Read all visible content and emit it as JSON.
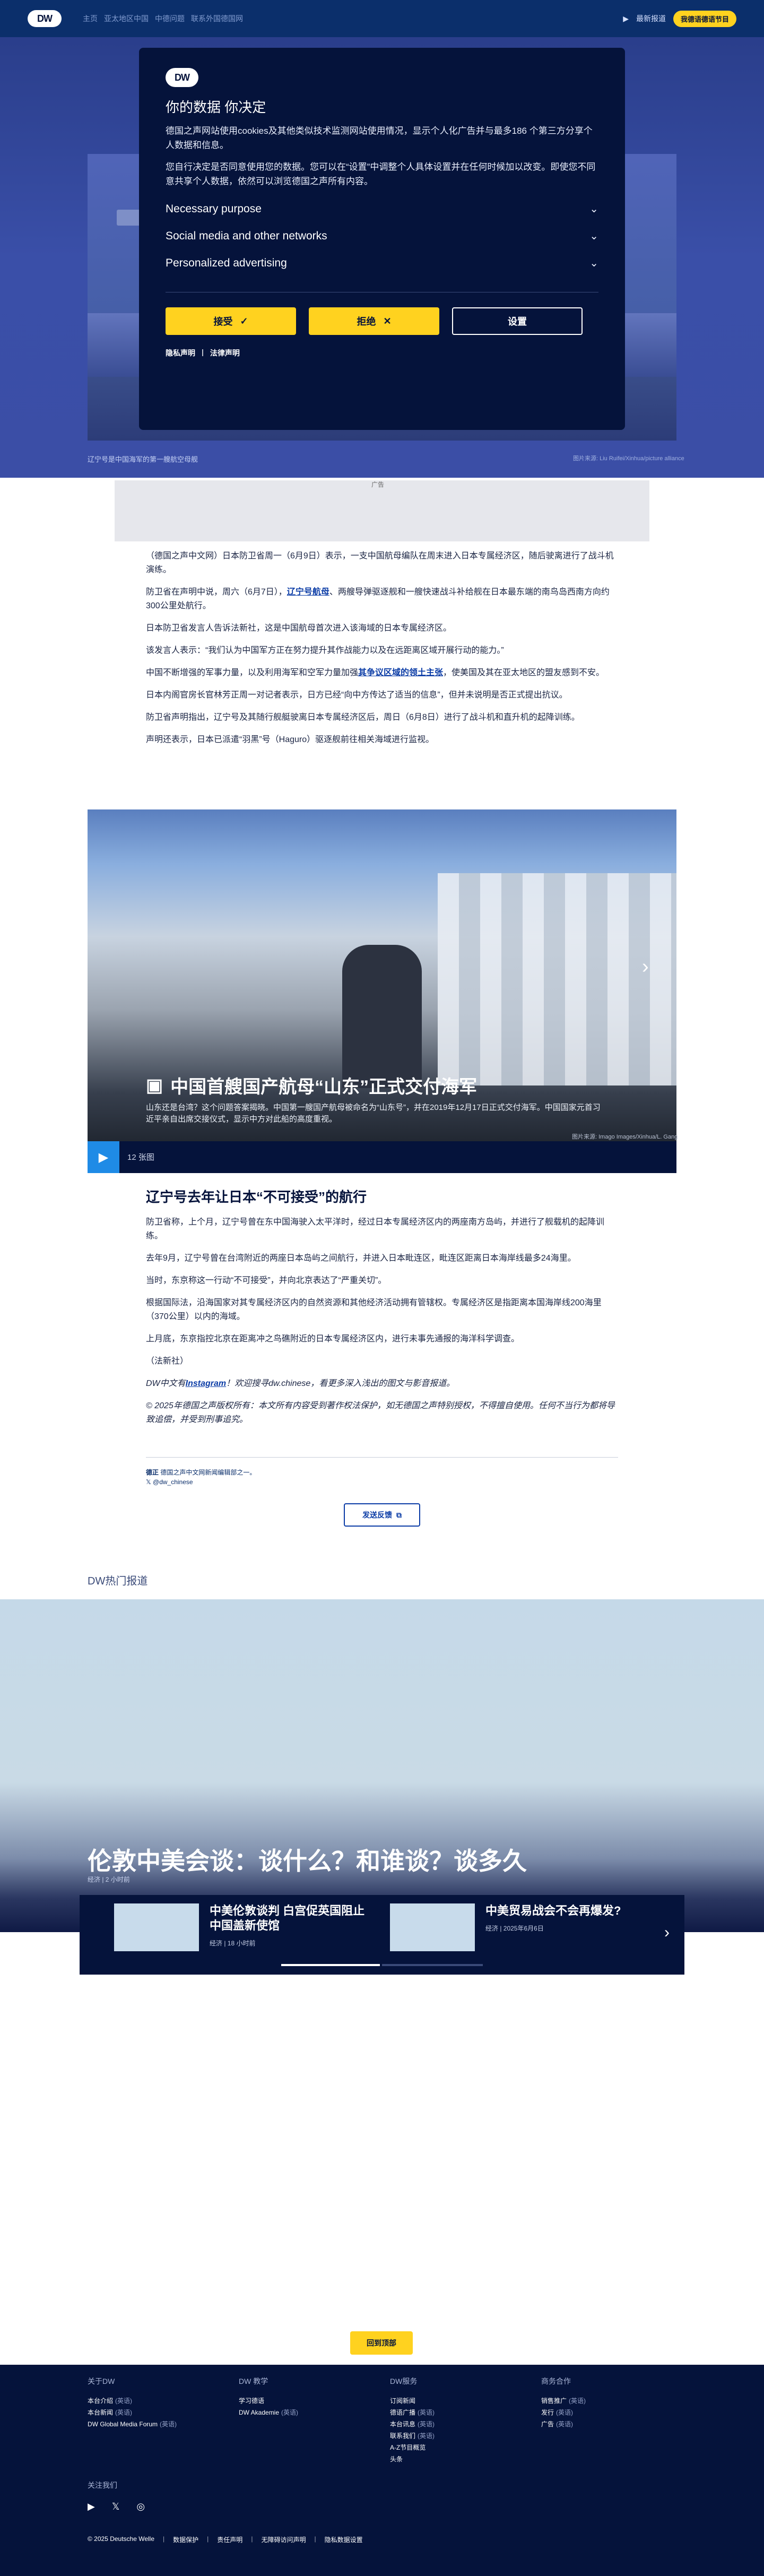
{
  "header": {
    "logo": "DW",
    "breadcrumbs": [
      "主页",
      "亚太地区中国",
      "中德问题",
      "联系外国德国网"
    ],
    "right_link_1": "最新报道",
    "lang_pill": "我德语德语节目"
  },
  "hero": {
    "caption": "辽宁号是中国海军的第一艘航空母舰",
    "credit": "图片来源: Liu Ruifei/Xinhua/picture alliance"
  },
  "consent": {
    "logo": "DW",
    "title": "你的数据 你决定",
    "p1": "德国之声网站使用cookies及其他类似技术监测网站使用情况，显示个人化广告并与最多186 个第三方分享个人数据和信息。",
    "p2": "您自行决定是否同意使用您的数据。您可以在“设置”中调整个人具体设置并在任何时候加以改变。即使您不同意共享个人数据，依然可以浏览德国之声所有内容。",
    "purposes": [
      "Necessary purpose",
      "Social media and other networks",
      "Personalized advertising"
    ],
    "accept": "接受",
    "reject": "拒绝",
    "settings": "设置",
    "privacy": "隐私声明",
    "legal": "法律声明"
  },
  "ad": {
    "label": "广告"
  },
  "article": {
    "p1": "（德国之声中文网）日本防卫省周一（6月9日）表示，一支中国航母编队在周末进入日本专属经济区，随后驶离进行了战斗机演练。",
    "p2a": "防卫省在声明中说，周六（6月7日），",
    "p2link": "辽宁号航母",
    "p2b": "、两艘导弹驱逐舰和一艘快速战斗补给舰在日本最东端的南鸟岛西南方向约300公里处航行。",
    "p3": "日本防卫省发言人告诉法新社，这是中国航母首次进入该海域的日本专属经济区。",
    "p4": "该发言人表示：“我们认为中国军方正在努力提升其作战能力以及在远距离区域开展行动的能力。”",
    "p5a": "中国不断增强的军事力量，以及利用海军和空军力量加强",
    "p5link": "其争议区域的领土主张",
    "p5b": "，使美国及其在亚太地区的盟友感到不安。",
    "p6": "日本内阁官房长官林芳正周一对记者表示，日方已经“向中方传达了适当的信息”，但并未说明是否正式提出抗议。",
    "p7": "防卫省声明指出，辽宁号及其随行舰艇驶离日本专属经济区后，周日（6月8日）进行了战斗机和直升机的起降训练。",
    "p8": "声明还表示，日本已派遣“羽黑”号（Haguro）驱逐舰前往相关海域进行监视。",
    "h3": "辽宁号去年让日本“不可接受”的航行",
    "p9": "防卫省称，上个月，辽宁号曾在东中国海驶入太平洋时，经过日本专属经济区内的两座南方岛屿，并进行了舰载机的起降训练。",
    "p10": "去年9月，辽宁号曾在台湾附近的两座日本岛屿之间航行，并进入日本毗连区，毗连区距离日本海岸线最多24海里。",
    "p11": "当时，东京称这一行动“不可接受”，并向北京表达了“严重关切”。",
    "p12": "根据国际法，沿海国家对其专属经济区内的自然资源和其他经济活动拥有管辖权。专属经济区是指距离本国海岸线200海里（370公里）以内的海域。",
    "p13": "上月底，东京指控北京在距离冲之鸟礁附近的日本专属经济区内，进行未事先通报的海洋科学调查。",
    "p14": "（法新社）",
    "p15a": "DW中文有",
    "p15link": "Instagram",
    "p15b": "！欢迎搜寻dw.chinese，看更多深入浅出的图文与影音报道。",
    "p16": "© 2025年德国之声版权所有：本文所有内容受到著作权法保护，如无德国之声特别授权，不得擅自使用。任何不当行为都将导致追偿，并受到刑事追究。",
    "meta1": "德国之声中文网新闻编辑部之一。",
    "meta1_label": "德正",
    "meta2": "@dw_chinese",
    "feedback": "发送反馈"
  },
  "gallery": {
    "title": "中国首艘国产航母“山东”正式交付海军",
    "sub": "山东还是台湾？这个问题答案揭晓。中国第一艘国产航母被命名为“山东号”，并在2019年12月17日正式交付海军。中国国家元首习近平亲自出席交接仪式，显示中方对此船的高度重视。",
    "credit": "图片来源: Imago Images/Xinhua/L. Gang",
    "count": "12 张图"
  },
  "hot": {
    "section": "DW热门报道",
    "headline": "伦敦中美会谈：谈什么？和谁谈？谈多久",
    "time": "经济 | 2 小时前",
    "cards": [
      {
        "title": "中美伦敦谈判 白宫促英国阻止中国盖新使馆",
        "meta": "经济 | 18 小时前"
      },
      {
        "title": "中美贸易战会不会再爆发?",
        "meta": "经济 | 2025年6月6日"
      }
    ]
  },
  "backtop": "回到顶部",
  "footer": {
    "cols": [
      {
        "title": "关于DW",
        "items": [
          [
            "本台介绍",
            "(英语)"
          ],
          [
            "本台新闻",
            "(英语)"
          ],
          [
            "DW Global Media Forum",
            "(英语)"
          ]
        ]
      },
      {
        "title": "DW 教学",
        "items": [
          [
            "学习德语",
            ""
          ],
          [
            "DW Akademie",
            "(英语)"
          ]
        ]
      },
      {
        "title": "DW服务",
        "items": [
          [
            "订阅新闻",
            ""
          ],
          [
            "德语广播",
            "(英语)"
          ],
          [
            "本台讯息",
            "(英语)"
          ],
          [
            "联系我们",
            "(英语)"
          ],
          [
            "A-Z节目概览",
            ""
          ],
          [
            "头条",
            ""
          ]
        ]
      },
      {
        "title": "商务合作",
        "items": [
          [
            "销售推广",
            "(英语)"
          ],
          [
            "发行",
            "(英语)"
          ],
          [
            "广告",
            "(英语)"
          ]
        ]
      }
    ],
    "follow": "关注我们",
    "legal": [
      "© 2025 Deutsche Welle",
      "数据保护",
      "责任声明",
      "无障碍访问声明",
      "隐私数据设置"
    ]
  },
  "colors": {
    "brand_navy": "#05133b",
    "accent_yellow": "#ffd21f",
    "link_blue": "#0b3ca6"
  }
}
